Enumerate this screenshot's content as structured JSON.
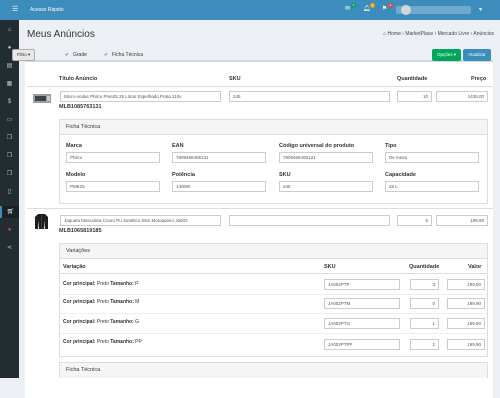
{
  "topbar": {
    "title": "Acesso Rápido",
    "badges": [
      "2",
      "6",
      "3"
    ],
    "icons": [
      "envelope-icon",
      "bell-icon",
      "flag-icon"
    ]
  },
  "page": {
    "title": "Meus Anúncios",
    "breadcrumb": {
      "home": "Home",
      "b1": "MarketPlace",
      "b2": "Mercado Livre",
      "b3": "Anúncios"
    }
  },
  "toolbar": {
    "filtro": "Filtro",
    "grade": "Grade",
    "ficha": "Ficha Técnica",
    "opcoes": "Opções",
    "atualizar": "Atualizar"
  },
  "table": {
    "h_titulo": "Título Anúncio",
    "h_sku": "SKU",
    "h_qtd": "Quantidade",
    "h_preco": "Preço"
  },
  "item1": {
    "titulo": "Micro-ondas Philco Pme25 25 Litros Espelhado Prata 110v",
    "sku": "245",
    "qtd": "10",
    "preco": "1438,00",
    "mlb": "MLB1085763131"
  },
  "ficha1": {
    "title": "Ficha Técnica",
    "marca_l": "Marca",
    "marca": "Philco",
    "ean_l": "EAN",
    "ean": "7809466406131",
    "cup_l": "Código universal do produto",
    "cup": "7809466406131",
    "tipo_l": "Tipo",
    "tipo": "De mesa",
    "modelo_l": "Modelo",
    "modelo": "PME25",
    "pot_l": "Potência",
    "pot": "1400W",
    "sku_l": "SKU",
    "sku": "245",
    "cap_l": "Capacidade",
    "cap": "25 L"
  },
  "item2": {
    "titulo": "Jaqueta Masculina Couro Pu Sintético Slim Motoqueiro Ja002",
    "sku": "",
    "qtd": "6",
    "preco": "199,90",
    "mlb": "MLB1065819185"
  },
  "variacoes": {
    "title": "Variações",
    "h_var": "Variação",
    "h_sku": "SKU",
    "h_qtd": "Quantidade",
    "h_valor": "Valor",
    "rows": [
      {
        "cor_l": "Cor principal:",
        "cor": "Preto",
        "tam_l": "Tamanho:",
        "tam": "P",
        "sku": "JA002PTP",
        "qtd": "3",
        "valor": "199,90"
      },
      {
        "cor_l": "Cor principal:",
        "cor": "Preto",
        "tam_l": "Tamanho:",
        "tam": "M",
        "sku": "JA002PTM",
        "qtd": "0",
        "valor": "199,90"
      },
      {
        "cor_l": "Cor principal:",
        "cor": "Preto",
        "tam_l": "Tamanho:",
        "tam": "G",
        "sku": "JA002PTG",
        "qtd": "1",
        "valor": "199,90"
      },
      {
        "cor_l": "Cor principal:",
        "cor": "Preto",
        "tam_l": "Tamanho:",
        "tam": "PP",
        "sku": "JA002PTPP",
        "qtd": "2",
        "valor": "199,90"
      }
    ]
  },
  "ficha2": {
    "title": "Ficha Técnica"
  }
}
